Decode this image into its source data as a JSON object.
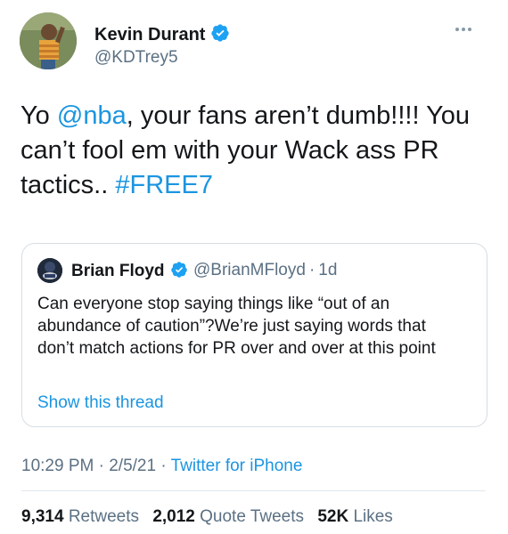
{
  "author": {
    "name": "Kevin Durant",
    "handle": "@KDTrey5"
  },
  "tweet": {
    "text_part1": "Yo ",
    "mention": "@nba",
    "text_part2": ",  your fans aren’t dumb!!!! You can’t fool em with your Wack ass PR tactics.. ",
    "hashtag": "#FREE7"
  },
  "quoted": {
    "name": "Brian Floyd",
    "handle": "@BrianMFloyd",
    "separator": "·",
    "age": "1d",
    "text": "Can everyone stop saying things like “out of an abundance of caution”?We’re just saying words that don’t match actions for PR over and over at this point",
    "show_thread": "Show this thread"
  },
  "meta": {
    "time": "10:29 PM",
    "separator": "·",
    "date": "2/5/21",
    "source": "Twitter for iPhone"
  },
  "stats": {
    "retweets_count": "9,314",
    "retweets_label": "Retweets",
    "quotes_count": "2,012",
    "quotes_label": "Quote Tweets",
    "likes_count": "52K",
    "likes_label": "Likes"
  },
  "colors": {
    "link": "#1b95e0",
    "muted": "#5b7083",
    "text": "#14171a",
    "border": "#d6dee4"
  },
  "icons": [
    "verified-badge-icon",
    "more-options-icon"
  ]
}
